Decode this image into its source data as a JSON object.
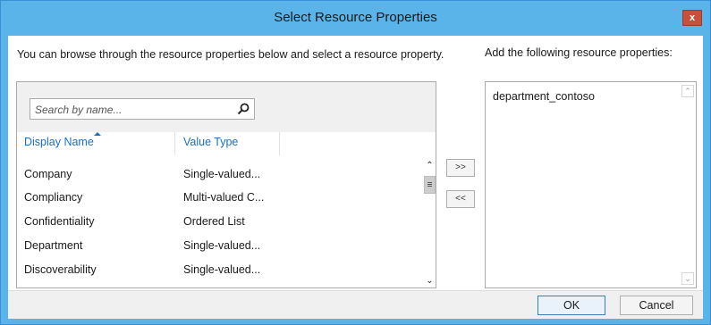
{
  "window": {
    "title": "Select Resource Properties",
    "close_label": "x"
  },
  "description": "You can browse through the resource properties below and select a resource property.",
  "search": {
    "placeholder": "Search by name..."
  },
  "columns": {
    "display_name": "Display Name",
    "value_type": "Value Type"
  },
  "rows": [
    {
      "name": "Company",
      "type": "Single-valued..."
    },
    {
      "name": "Compliancy",
      "type": "Multi-valued C..."
    },
    {
      "name": "Confidentiality",
      "type": "Ordered List"
    },
    {
      "name": "Department",
      "type": "Single-valued..."
    },
    {
      "name": "Discoverability",
      "type": "Single-valued..."
    }
  ],
  "buttons": {
    "add": ">>",
    "remove": "<<",
    "ok": "OK",
    "cancel": "Cancel"
  },
  "right_panel": {
    "label": "Add the following resource properties:",
    "items": [
      "department_contoso"
    ]
  },
  "colors": {
    "title_bar": "#5ab4ea",
    "close": "#c7503d",
    "header_link": "#1f6fb5"
  },
  "icons": {
    "search": "magnifier-icon",
    "sort": "sort-ascending-icon"
  }
}
